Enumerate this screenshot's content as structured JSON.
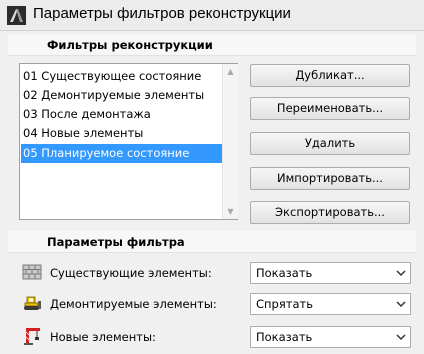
{
  "window": {
    "title": "Параметры фильтров реконструкции",
    "icon": "archicad-app-icon"
  },
  "filters_section": {
    "header": "Фильтры реконструкции",
    "list": [
      {
        "label": "01 Существующее состояние",
        "selected": false
      },
      {
        "label": "02 Демонтируемые элементы",
        "selected": false
      },
      {
        "label": "03 После демонтажа",
        "selected": false
      },
      {
        "label": "04 Новые элементы",
        "selected": false
      },
      {
        "label": "05 Планируемое состояние",
        "selected": true
      }
    ],
    "buttons": {
      "duplicate": "Дубликат...",
      "rename": "Переименовать...",
      "delete": "Удалить",
      "import": "Импортировать...",
      "export": "Экспортировать..."
    }
  },
  "params_section": {
    "header": "Параметры фильтра",
    "rows": [
      {
        "icon": "brick-wall-icon",
        "label": "Существующие элементы:",
        "value": "Показать"
      },
      {
        "icon": "bulldozer-icon",
        "label": "Демонтируемые элементы:",
        "value": "Спрятать"
      },
      {
        "icon": "crane-icon",
        "label": "Новые элементы:",
        "value": "Показать"
      }
    ]
  },
  "colors": {
    "selection": "#3399ff",
    "dialog_background": "#f0f0f0"
  }
}
